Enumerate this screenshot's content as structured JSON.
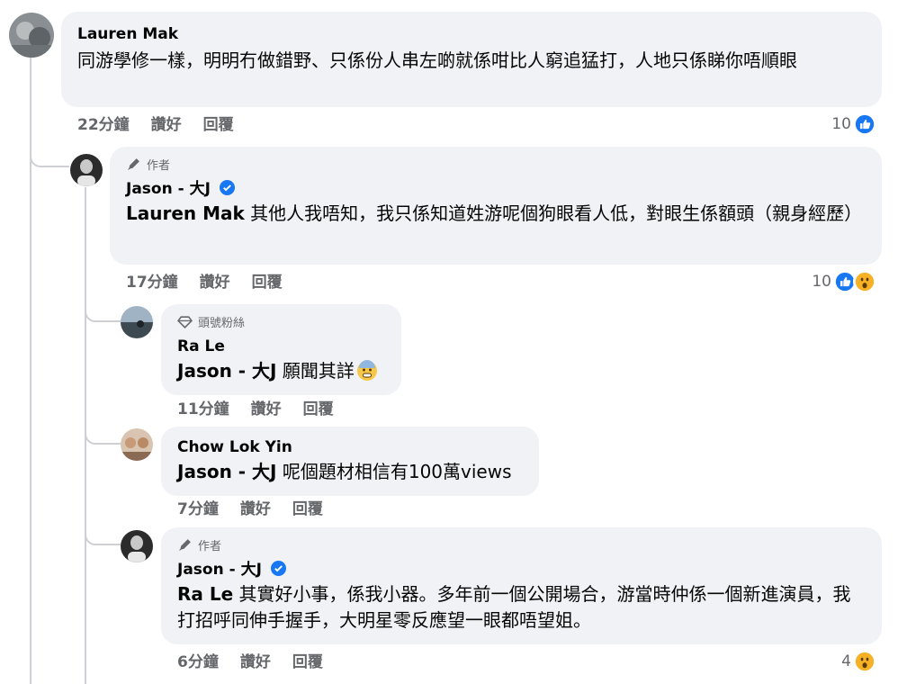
{
  "colors": {
    "bubble": "#f0f2f5",
    "meta": "#65676b",
    "like_blue": "#1877f2",
    "wow_yellow": "#f7b125",
    "thread_line": "#ced0d4"
  },
  "comments": [
    {
      "author": "Lauren Mak",
      "text": "同游學修一樣，明明冇做錯野、只係份人串左啲就係咁比人窮追猛打，人地只係睇你唔順眼",
      "time": "22分鐘",
      "like_label": "讚好",
      "reply_label": "回覆",
      "reaction_count": "10",
      "reactions": [
        "like-icon"
      ]
    },
    {
      "badge": "作者",
      "badge_icon": "pencil-icon",
      "author": "Jason - 大J",
      "verified": true,
      "mention": "Lauren Mak",
      "text": " 其他人我唔知，我只係知道姓游呢個狗眼看人低，對眼生係額頭（親身經歷）",
      "time": "17分鐘",
      "like_label": "讚好",
      "reply_label": "回覆",
      "reaction_count": "10",
      "reactions": [
        "like-icon",
        "wow-icon"
      ]
    },
    {
      "badge": "頭號粉絲",
      "badge_icon": "diamond-icon",
      "author": "Ra Le",
      "mention": "Jason - 大J",
      "text": " 願聞其詳",
      "emoji": "fearful-face-icon",
      "time": "11分鐘",
      "like_label": "讚好",
      "reply_label": "回覆"
    },
    {
      "author": "Chow Lok Yin",
      "mention": "Jason - 大J",
      "text": " 呢個題材相信有100萬views",
      "time": "7分鐘",
      "like_label": "讚好",
      "reply_label": "回覆"
    },
    {
      "badge": "作者",
      "badge_icon": "pencil-icon",
      "author": "Jason - 大J",
      "verified": true,
      "mention": "Ra Le",
      "text": " 其實好小事，係我小器。多年前一個公開場合，游當時仲係一個新進演員，我打招呼同伸手握手，大明星零反應望一眼都唔望姐。",
      "time": "6分鐘",
      "like_label": "讚好",
      "reply_label": "回覆",
      "reaction_count": "4",
      "reactions": [
        "wow-icon"
      ]
    }
  ]
}
